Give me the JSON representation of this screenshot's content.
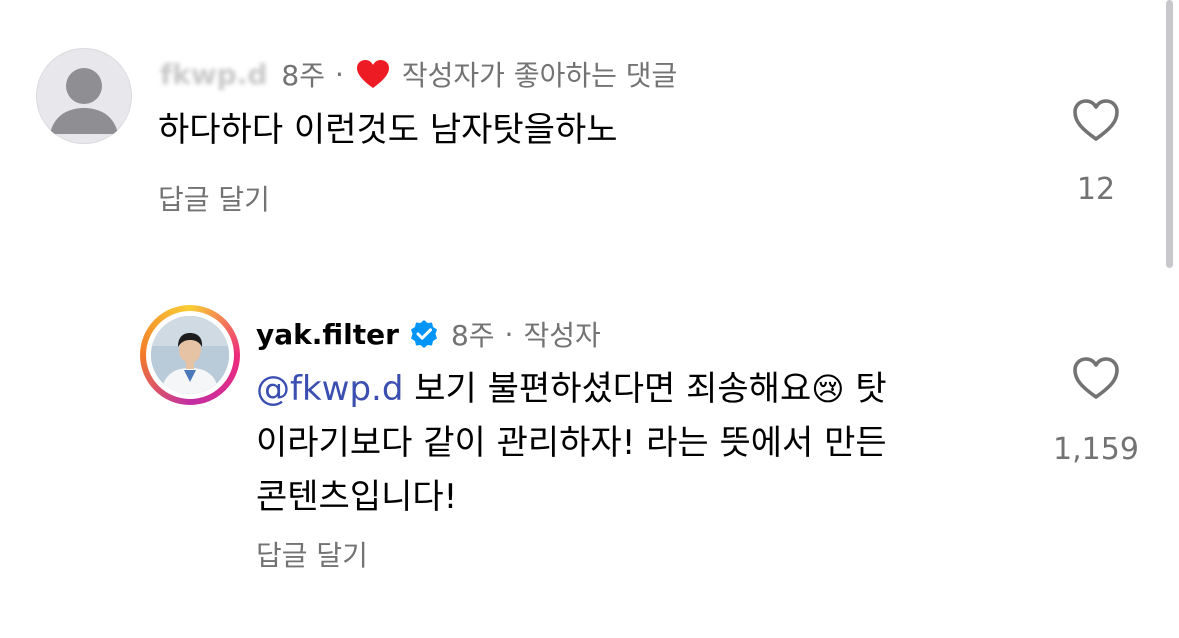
{
  "comments": [
    {
      "username": "fkwp.d",
      "time": "8주",
      "separator": "·",
      "badge": "작성자가 좋아하는 댓글",
      "text": "하다하다 이런것도 남자탓을하노",
      "reply_label": "답글 달기",
      "like_count": "12",
      "avatar": "default-avatar-icon",
      "liked_by_author_icon": "red-heart-icon"
    },
    {
      "username": "yak.filter",
      "verified_icon": "verified-badge-icon",
      "time": "8주",
      "separator": "·",
      "author_tag": "작성자",
      "mention": "@fkwp.d",
      "text_line1": " 보기 불편하셨다면 죄송해요",
      "emoji": "😢",
      "text_line1_end": " 탓",
      "text_line2": "이라기보다 같이 관리하자! 라는 뜻에서 만든",
      "text_line3": "콘텐츠입니다!",
      "reply_label": "답글 달기",
      "like_count": "1,159",
      "avatar": "story-ring-avatar"
    }
  ],
  "colors": {
    "meta_gray": "#737373",
    "mention_blue": "#3a4fb0",
    "heart_red": "#ed1c24",
    "verified_blue": "#0095f6"
  }
}
